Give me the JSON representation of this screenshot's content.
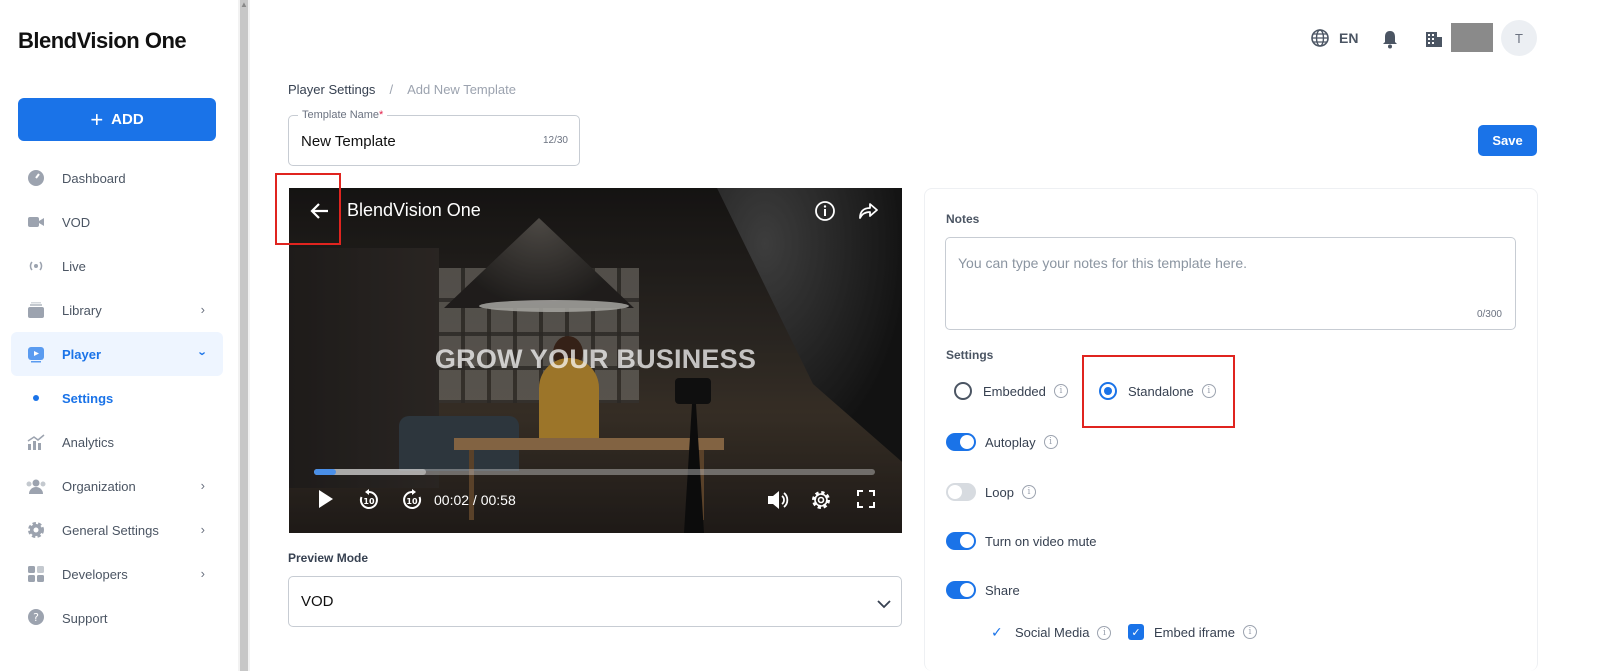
{
  "sidebar": {
    "logo": "BlendVision One",
    "add_label": "ADD",
    "items": [
      {
        "label": "Dashboard",
        "icon": "dashboard-gauge-icon"
      },
      {
        "label": "VOD",
        "icon": "video-camera-icon"
      },
      {
        "label": "Live",
        "icon": "broadcast-icon"
      },
      {
        "label": "Library",
        "icon": "library-stack-icon",
        "chevron": "right"
      },
      {
        "label": "Player",
        "icon": "player-icon",
        "chevron": "down",
        "active": true
      },
      {
        "label": "Settings",
        "sub": true,
        "active": true
      },
      {
        "label": "Analytics",
        "icon": "analytics-chart-icon"
      },
      {
        "label": "Organization",
        "icon": "organization-people-icon",
        "chevron": "right"
      },
      {
        "label": "General Settings",
        "icon": "gear-icon",
        "chevron": "right"
      },
      {
        "label": "Developers",
        "icon": "developers-grid-icon",
        "chevron": "right"
      },
      {
        "label": "Support",
        "icon": "support-question-icon"
      }
    ]
  },
  "topbar": {
    "language": "EN",
    "avatar_initial": "T"
  },
  "breadcrumb": {
    "parent": "Player Settings",
    "separator": "/",
    "current": "Add New Template"
  },
  "template_name": {
    "label": "Template Name",
    "required_mark": "*",
    "value": "New Template",
    "count": "12/30"
  },
  "save_label": "Save",
  "video": {
    "title": "BlendVision One",
    "headline": "GROW YOUR BUSINESS",
    "time": "00:02 / 00:58",
    "played_fraction": 0.04,
    "buffered_fraction": 0.2
  },
  "preview_mode": {
    "label": "Preview Mode",
    "value": "VOD"
  },
  "notes": {
    "label": "Notes",
    "placeholder": "You can type your notes for this template here.",
    "count": "0/300"
  },
  "settings": {
    "label": "Settings",
    "embedded_label": "Embedded",
    "standalone_label": "Standalone",
    "selected_mode": "Standalone",
    "autoplay_label": "Autoplay",
    "autoplay_on": true,
    "loop_label": "Loop",
    "loop_on": false,
    "mute_label": "Turn on video mute",
    "mute_on": true,
    "share_label": "Share",
    "share_on": true,
    "social_media_label": "Social Media",
    "embed_iframe_label": "Embed iframe"
  },
  "colors": {
    "accent": "#1a73e8",
    "highlight": "#e0241f"
  }
}
